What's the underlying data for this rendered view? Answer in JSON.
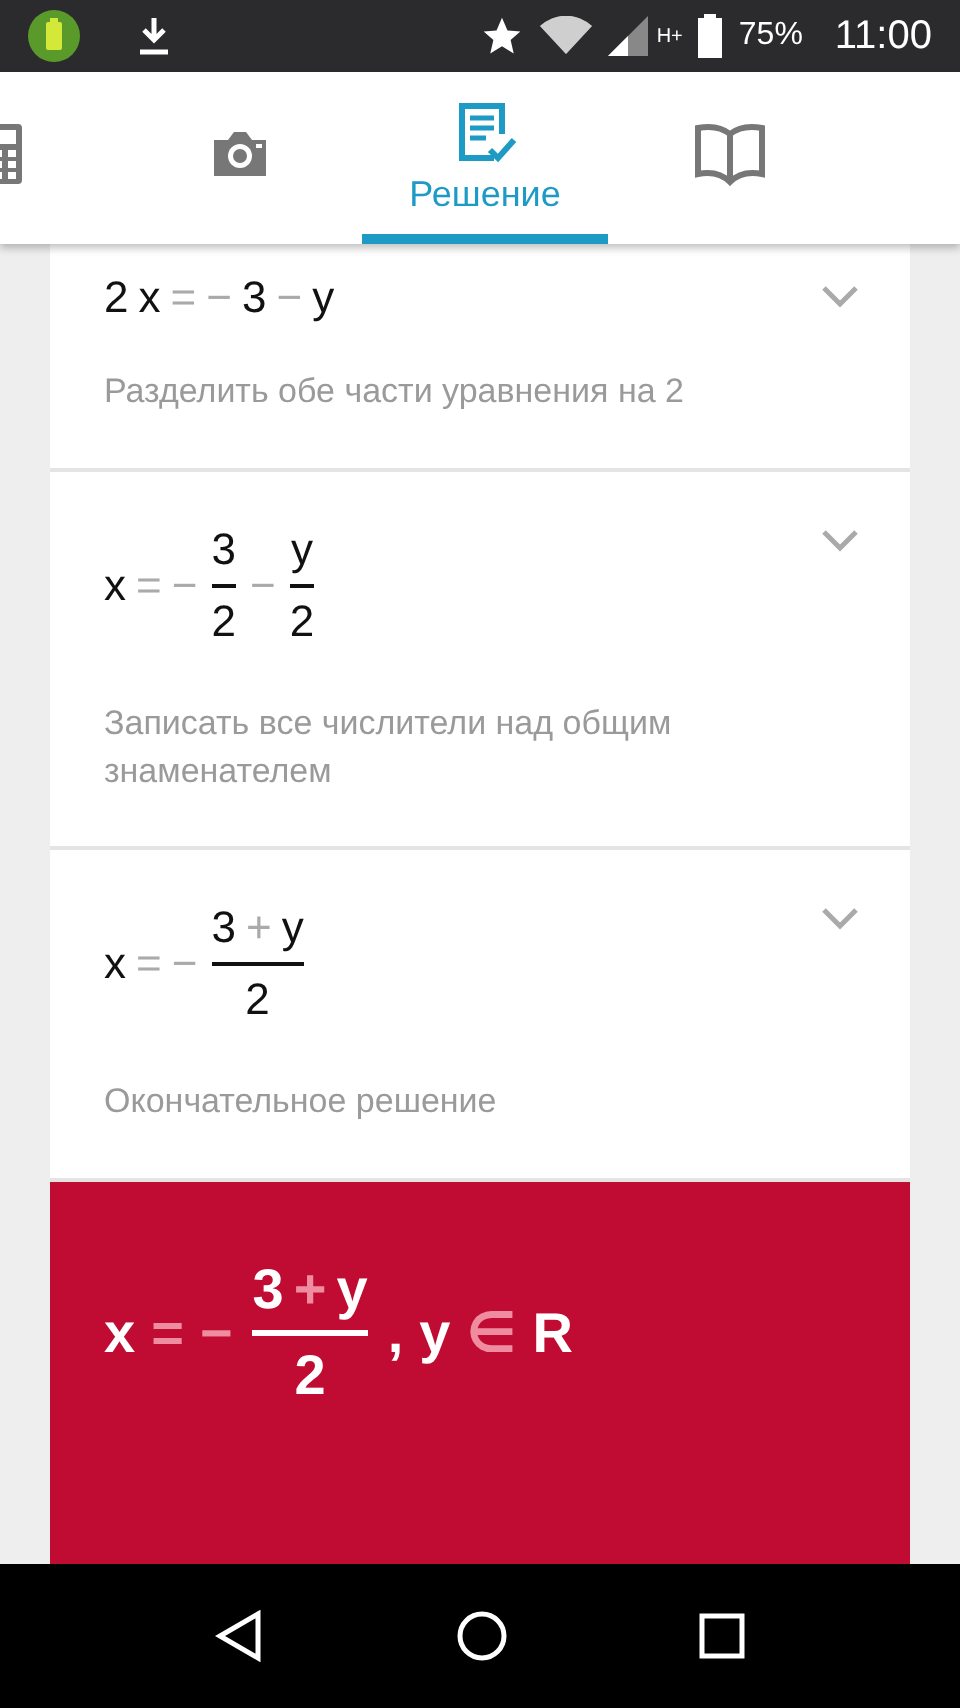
{
  "status_bar": {
    "network": "H+",
    "battery": "75%",
    "time": "11:00"
  },
  "tabs": [
    {
      "kind": "calculator",
      "selected": false
    },
    {
      "kind": "camera",
      "selected": false
    },
    {
      "kind": "solution",
      "label": "Решение",
      "selected": true
    },
    {
      "kind": "book",
      "selected": false
    }
  ],
  "steps": [
    {
      "expression": [
        {
          "kind": "term",
          "text": "2"
        },
        {
          "kind": "term",
          "text": "x"
        },
        {
          "kind": "op",
          "text": "="
        },
        {
          "kind": "op",
          "text": "−"
        },
        {
          "kind": "term",
          "text": "3"
        },
        {
          "kind": "op",
          "text": "−"
        },
        {
          "kind": "term",
          "text": "y"
        }
      ],
      "explanation": "Разделить обе части уравнения на 2"
    },
    {
      "expression": [
        {
          "kind": "term",
          "text": "x"
        },
        {
          "kind": "op",
          "text": "="
        },
        {
          "kind": "op",
          "text": "−"
        },
        {
          "kind": "frac",
          "num": [
            {
              "kind": "term",
              "text": "3"
            }
          ],
          "den": [
            {
              "kind": "term",
              "text": "2"
            }
          ]
        },
        {
          "kind": "op",
          "text": "−"
        },
        {
          "kind": "frac",
          "num": [
            {
              "kind": "term",
              "text": "y"
            }
          ],
          "den": [
            {
              "kind": "term",
              "text": "2"
            }
          ]
        }
      ],
      "explanation": "Записать все числители над общим знаменателем"
    },
    {
      "expression": [
        {
          "kind": "term",
          "text": "x"
        },
        {
          "kind": "op",
          "text": "="
        },
        {
          "kind": "op",
          "text": "−"
        },
        {
          "kind": "frac",
          "num": [
            {
              "kind": "term",
              "text": "3"
            },
            {
              "kind": "op",
              "text": "+"
            },
            {
              "kind": "term",
              "text": "y"
            }
          ],
          "den": [
            {
              "kind": "term",
              "text": "2"
            }
          ]
        }
      ],
      "explanation": "Окончательное решение"
    }
  ],
  "final": {
    "expression": [
      {
        "kind": "term",
        "text": "x"
      },
      {
        "kind": "op",
        "text": "="
      },
      {
        "kind": "op",
        "text": "−"
      },
      {
        "kind": "frac",
        "num": [
          {
            "kind": "term",
            "text": "3"
          },
          {
            "kind": "op",
            "text": "+"
          },
          {
            "kind": "term",
            "text": "y"
          }
        ],
        "den": [
          {
            "kind": "term",
            "text": "2"
          }
        ]
      },
      {
        "kind": "term",
        "text": ","
      },
      {
        "kind": "term",
        "text": "y"
      },
      {
        "kind": "op",
        "text": "∈"
      },
      {
        "kind": "term",
        "text": "R"
      }
    ]
  }
}
